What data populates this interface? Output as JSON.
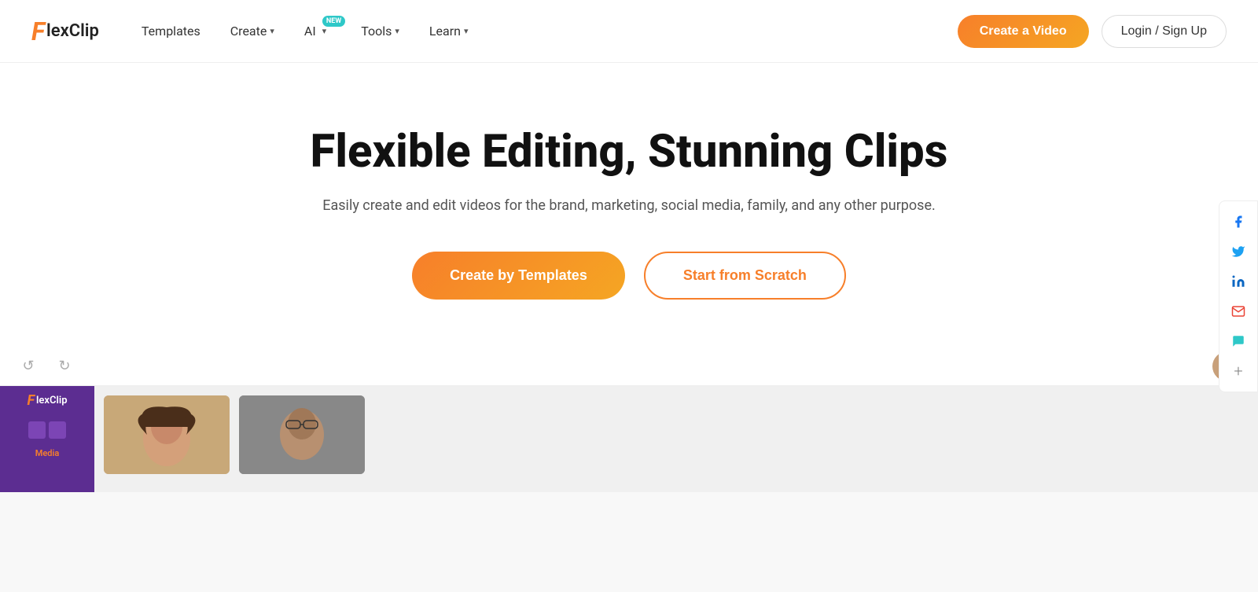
{
  "brand": {
    "logo_f": "F",
    "logo_text": "lexClip"
  },
  "navbar": {
    "templates_label": "Templates",
    "create_label": "Create",
    "ai_label": "AI",
    "ai_badge": "NEW",
    "tools_label": "Tools",
    "learn_label": "Learn",
    "create_video_btn": "Create a Video",
    "login_btn": "Login / Sign Up"
  },
  "hero": {
    "title": "Flexible Editing, Stunning Clips",
    "subtitle": "Easily create and edit videos for the brand, marketing, social media, family, and any other purpose.",
    "btn_templates": "Create by Templates",
    "btn_scratch": "Start from Scratch"
  },
  "social": {
    "facebook": "f",
    "twitter": "🐦",
    "linkedin": "in",
    "email": "✉",
    "chat": "💬",
    "plus": "+"
  },
  "editor": {
    "undo_label": "↺",
    "redo_label": "↻",
    "logo_f": "F",
    "logo_text": "lexClip",
    "media_label": "Media"
  }
}
